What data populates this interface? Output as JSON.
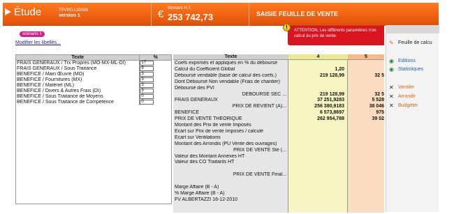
{
  "header": {
    "app_name": "Étude",
    "doc_code": "TPVRD-L00009",
    "version": "version 1",
    "amount_caption": "Montant H.T.",
    "currency_symbol": "€",
    "amount": "253 742,73",
    "title": "SAISIE FEUILLE DE VENTE",
    "colors": {
      "header": "#e2500a",
      "warning": "#d9141e",
      "scenario": "#d81e8a"
    }
  },
  "scenario": {
    "badge": "scénario 1",
    "link": "Modifier les libellés..."
  },
  "warning": {
    "icon": "warning-icon",
    "line1": "ATTENTION, Les différents paramètres n'on",
    "line2": "calcul du prix de vente."
  },
  "left_table": {
    "headers": [
      "Texte",
      "%"
    ],
    "rows": [
      {
        "label": "FRAIS GENERAUX / Trx Propres (MO-MX-ML-DI)",
        "value": "17"
      },
      {
        "label": "FRAIS GENERAUX / Sous Traitance",
        "value": "5"
      },
      {
        "label": "BENEFICE / Main Œuvre (MO)",
        "value": "3"
      },
      {
        "label": "BENEFICE / Fournitures (MX)",
        "value": "3"
      },
      {
        "label": "BENEFICE / Matériel (ML)",
        "value": "3"
      },
      {
        "label": "BENEFICE / Divers & Autres Frais (DI)",
        "value": "3"
      },
      {
        "label": "BENEFICE / Sous Traitance de Moyens",
        "value": "0"
      },
      {
        "label": "BENEFICE / Sous Traitance de Compétence",
        "value": "0"
      }
    ]
  },
  "grid": {
    "headers": [
      "Texte",
      "4",
      "5"
    ],
    "rows": [
      {
        "label": "Coefs exprimés et appliqués en % du déboursé",
        "c4": "",
        "c5": "",
        "indent": false
      },
      {
        "label": "Calcul du Coefficient Global",
        "c4": "1,20",
        "c5": "",
        "indent": false
      },
      {
        "label": "Déboursé vendable (base de calcul des coefs.)",
        "c4": "219 128,99",
        "c5": "32 5",
        "indent": false
      },
      {
        "label": "Dont Déboursé Non vendable (Frais de chantier)",
        "c4": "",
        "c5": "",
        "indent": false
      },
      {
        "label": "Déboursé des PVI",
        "c4": "",
        "c5": "",
        "indent": false
      },
      {
        "label": "DEBOURSE SEC ...",
        "c4": "219 128,99",
        "c5": "32 5",
        "indent": true
      },
      {
        "label": "FRAIS GENERAUX",
        "c4": "37 251,9283",
        "c5": "5 528",
        "indent": false
      },
      {
        "label": "PRIX DE REVIENT (A)...",
        "c4": "256 380,9183",
        "c5": "38 046",
        "indent": true
      },
      {
        "label": "BENEFICE",
        "c4": "6 573,8697",
        "c5": "975",
        "indent": false
      },
      {
        "label": "PRIX DE VENTE THEORIQUE",
        "c4": "262 954,788",
        "c5": "39 02",
        "indent": false
      },
      {
        "label": "Montant des Prix de vente Imposés",
        "c4": "",
        "c5": "",
        "indent": false
      },
      {
        "label": "Ecart sur Prix de vente Imposés / calculé",
        "c4": "",
        "c5": "",
        "indent": false
      },
      {
        "label": "Ecart sur Ventilations",
        "c4": "",
        "c5": "",
        "indent": false
      },
      {
        "label": "Montant des Arrondis (PU Vente des ouvrages)",
        "c4": "",
        "c5": "",
        "indent": false
      },
      {
        "label": "PRIX DE VENTE Sté (...",
        "c4": "",
        "c5": "",
        "indent": true
      },
      {
        "label": "Valeur des Montant Annexes HT",
        "c4": "",
        "c5": "",
        "indent": false
      },
      {
        "label": "Valeur des CO Traitants HT",
        "c4": "",
        "c5": "",
        "indent": false
      },
      {
        "label": "",
        "c4": "",
        "c5": "",
        "indent": false
      },
      {
        "label": "PRIX DE VENTE Final...",
        "c4": "",
        "c5": "",
        "indent": true
      },
      {
        "label": "",
        "c4": "",
        "c5": "",
        "indent": false
      },
      {
        "label": "Marge Affaire (B - A)",
        "c4": "",
        "c5": "",
        "indent": false
      },
      {
        "label": "% Marge Affaire (B - A)",
        "c4": "",
        "c5": "",
        "indent": false
      },
      {
        "label": "FV ALBERTAZZI 16-12-2010",
        "c4": "",
        "c5": "",
        "indent": false
      }
    ]
  },
  "sidebar": {
    "items": [
      {
        "label": "Feuille de calcu",
        "icon": "pencil-icon"
      },
      {
        "label": "Editions",
        "icon": "eye-icon"
      },
      {
        "label": "Statistiques",
        "icon": "eye-icon"
      },
      {
        "label": "Ventiler",
        "icon": "tools-icon"
      },
      {
        "label": "Arrondir",
        "icon": "tools-icon"
      },
      {
        "label": "Budgéter",
        "icon": "tools-icon"
      }
    ]
  }
}
